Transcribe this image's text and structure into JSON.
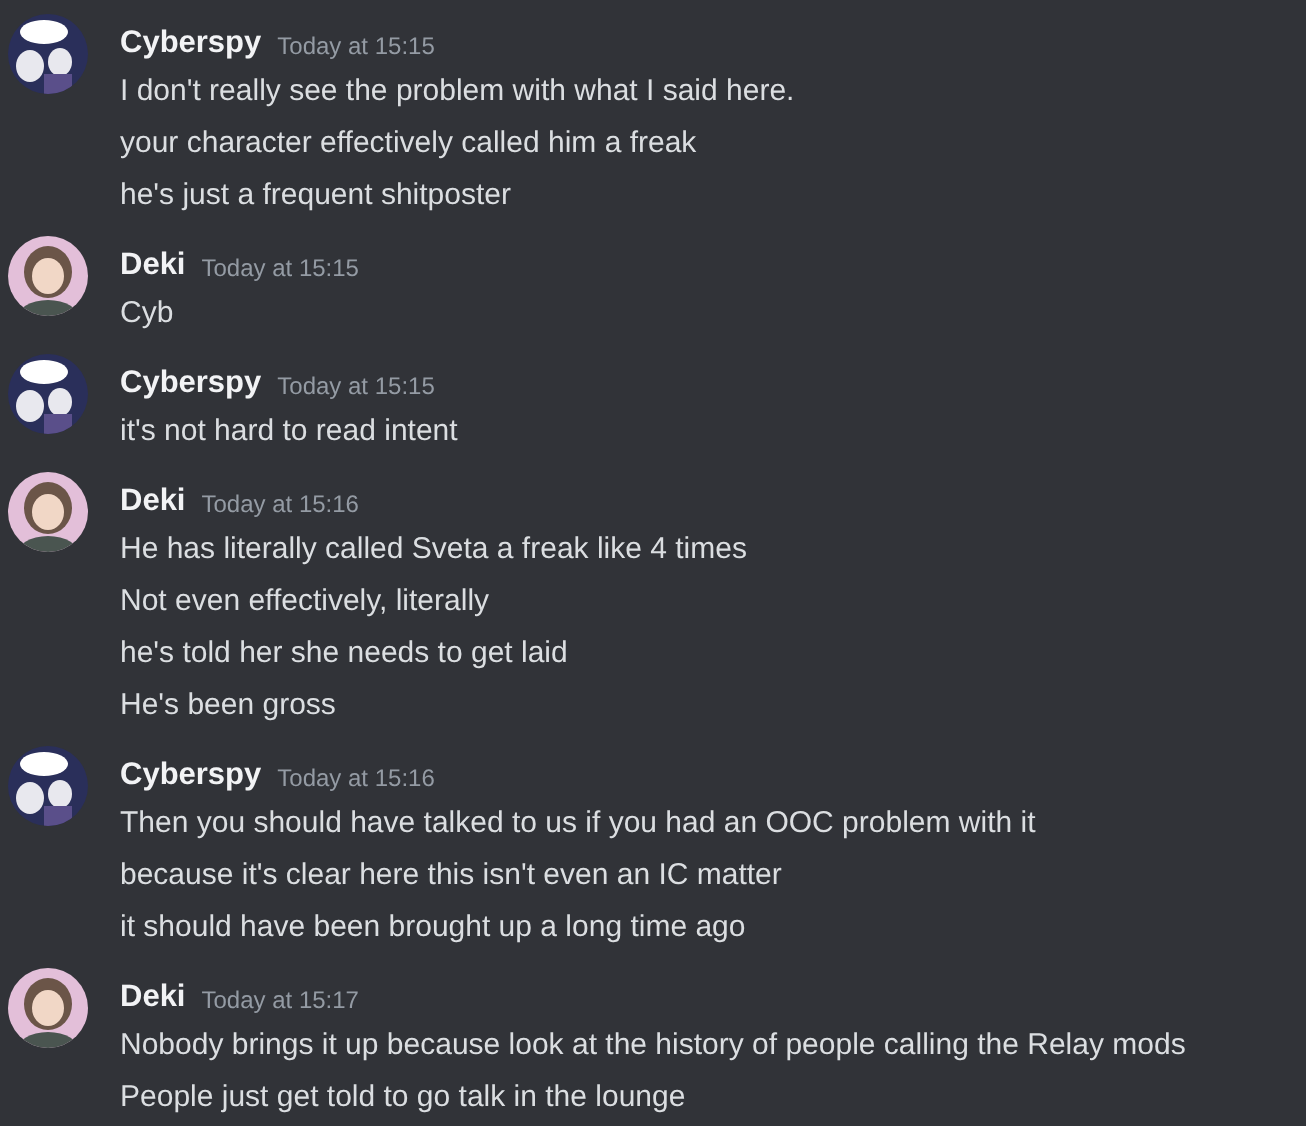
{
  "messages": [
    {
      "author": "Cyberspy",
      "avatar": {
        "kind": "dark"
      },
      "time": "Today at 15:15",
      "lines": [
        "I don't really see the problem with what I said here.",
        "your character effectively called him a freak",
        "he's just a frequent shitposter"
      ]
    },
    {
      "author": "Deki",
      "avatar": {
        "kind": "pink"
      },
      "time": "Today at 15:15",
      "lines": [
        "Cyb"
      ]
    },
    {
      "author": "Cyberspy",
      "avatar": {
        "kind": "dark"
      },
      "time": "Today at 15:15",
      "lines": [
        "it's not hard to read intent"
      ]
    },
    {
      "author": "Deki",
      "avatar": {
        "kind": "pink"
      },
      "time": "Today at 15:16",
      "lines": [
        "He has literally called Sveta a freak like 4 times",
        "Not even effectively, literally",
        "he's told her she needs to get laid",
        "He's been gross"
      ]
    },
    {
      "author": "Cyberspy",
      "avatar": {
        "kind": "dark"
      },
      "time": "Today at 15:16",
      "lines": [
        "Then you should have talked to us if you had an OOC problem with it",
        "because it's clear here this isn't even an IC matter",
        "it should have been brought up a long time ago"
      ]
    },
    {
      "author": "Deki",
      "avatar": {
        "kind": "pink"
      },
      "time": "Today at 15:17",
      "lines": [
        "Nobody brings it up because look at the history of people calling the Relay mods",
        "People just get told to go talk in the lounge"
      ]
    }
  ]
}
